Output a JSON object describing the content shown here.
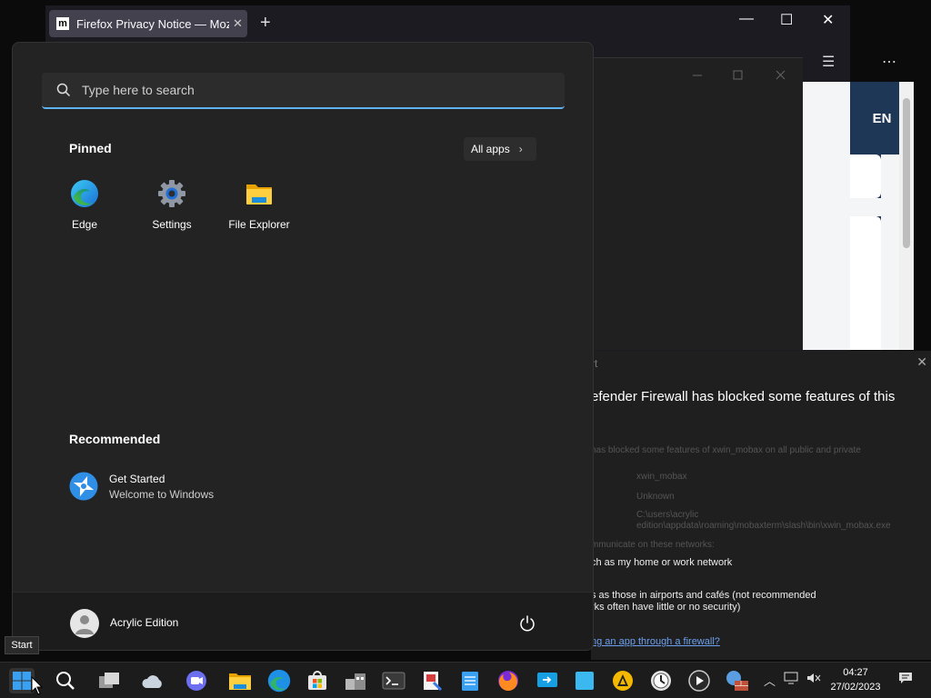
{
  "firefox": {
    "tab_title": "Firefox Privacy Notice — Mozill",
    "tab_favicon": "m",
    "tab_close": "✕",
    "new_tab": "+",
    "minimize": "—",
    "maximize": "☐",
    "close": "✕"
  },
  "background_page": {
    "lang_label": "EN"
  },
  "firewall": {
    "title_fragment": "rt",
    "heading": "efender Firewall has blocked some features of this",
    "desc": "has blocked some features of xwin_mobax on all public and private",
    "name_value": "xwin_mobax",
    "publisher_value": "Unknown",
    "path_value": "C:\\users\\acrylic edition\\appdata\\roaming\\mobaxterm\\slash\\bin\\xwin_mobax.exe",
    "allow_label": "mmunicate on these networks:",
    "private_label": "ch as my home or work network",
    "public_line1": "s as those in airports and cafés (not recommended",
    "public_line2": "rks often have little or no security)",
    "help_link": "ng an app through a firewall?"
  },
  "start_menu": {
    "search_placeholder": "Type here to search",
    "pinned_title": "Pinned",
    "all_apps_label": "All apps",
    "pinned": [
      {
        "label": "Edge",
        "icon": "edge-icon"
      },
      {
        "label": "Settings",
        "icon": "settings-gear-icon"
      },
      {
        "label": "File Explorer",
        "icon": "folder-icon"
      }
    ],
    "recommended_title": "Recommended",
    "recommended": [
      {
        "title": "Get Started",
        "subtitle": "Welcome to Windows",
        "icon": "get-started-icon"
      }
    ],
    "user_name": "Acrylic Edition",
    "power_icon": "power-icon"
  },
  "tooltip": {
    "text": "Start"
  },
  "taskbar": {
    "icons": [
      "start-icon",
      "search-icon",
      "task-view-icon",
      "weather-icon",
      "chat-icon",
      "file-explorer-icon",
      "edge-icon",
      "store-icon",
      "package-icon",
      "terminal-icon",
      "paint-icon",
      "notepad-icon",
      "firefox-icon",
      "remote-desktop-icon",
      "app-icon",
      "vlc-icon",
      "timer-icon",
      "media-player-icon",
      "network-wall-icon"
    ],
    "time": "04:27",
    "date": "27/02/2023"
  },
  "colors": {
    "accent": "#5fb2f2",
    "start_bg": "#232323",
    "taskbar_bg": "#1c1c1c"
  }
}
